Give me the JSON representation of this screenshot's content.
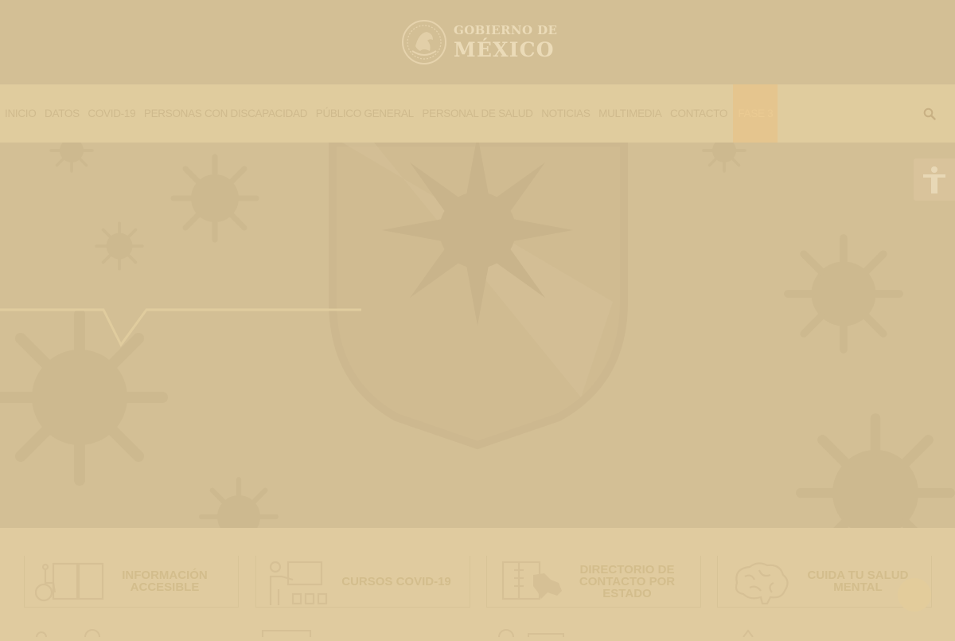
{
  "header": {
    "logo_line1": "GOBIERNO DE",
    "logo_line2": "MÉXICO"
  },
  "nav": {
    "items": [
      {
        "label": "INICIO"
      },
      {
        "label": "DATOS"
      },
      {
        "label": "COVID-19"
      },
      {
        "label": "PERSONAS CON DISCAPACIDAD"
      },
      {
        "label": "PÚBLICO GENERAL"
      },
      {
        "label": "PERSONAL DE SALUD"
      },
      {
        "label": "NOTICIAS"
      },
      {
        "label": "MULTIMEDIA"
      },
      {
        "label": "CONTACTO"
      },
      {
        "label": "FASE 3"
      }
    ],
    "active_item": "FASE 3",
    "search_icon": "search-icon"
  },
  "accessibility": {
    "icon": "accessibility-person-icon"
  },
  "cards": [
    {
      "label": "INFORMACIÓN ACCESIBLE",
      "icon": "wheelchair-book-icon"
    },
    {
      "label": "CURSOS COVID-19",
      "icon": "teacher-board-icon"
    },
    {
      "label": "DIRECTORIO DE CONTACTO POR ESTADO",
      "icon": "directory-map-icon"
    },
    {
      "label": "CUIDA TU SALUD MENTAL",
      "icon": "brain-icon"
    }
  ],
  "colors": {
    "header_bg": "#d3bf95",
    "nav_bg": "#e0cc9e",
    "nav_text": "#cfba8d",
    "active_tab_bg": "#e5c58e",
    "card_text": "#d3bd8c",
    "overlay_tint": "#e0cb9f"
  }
}
